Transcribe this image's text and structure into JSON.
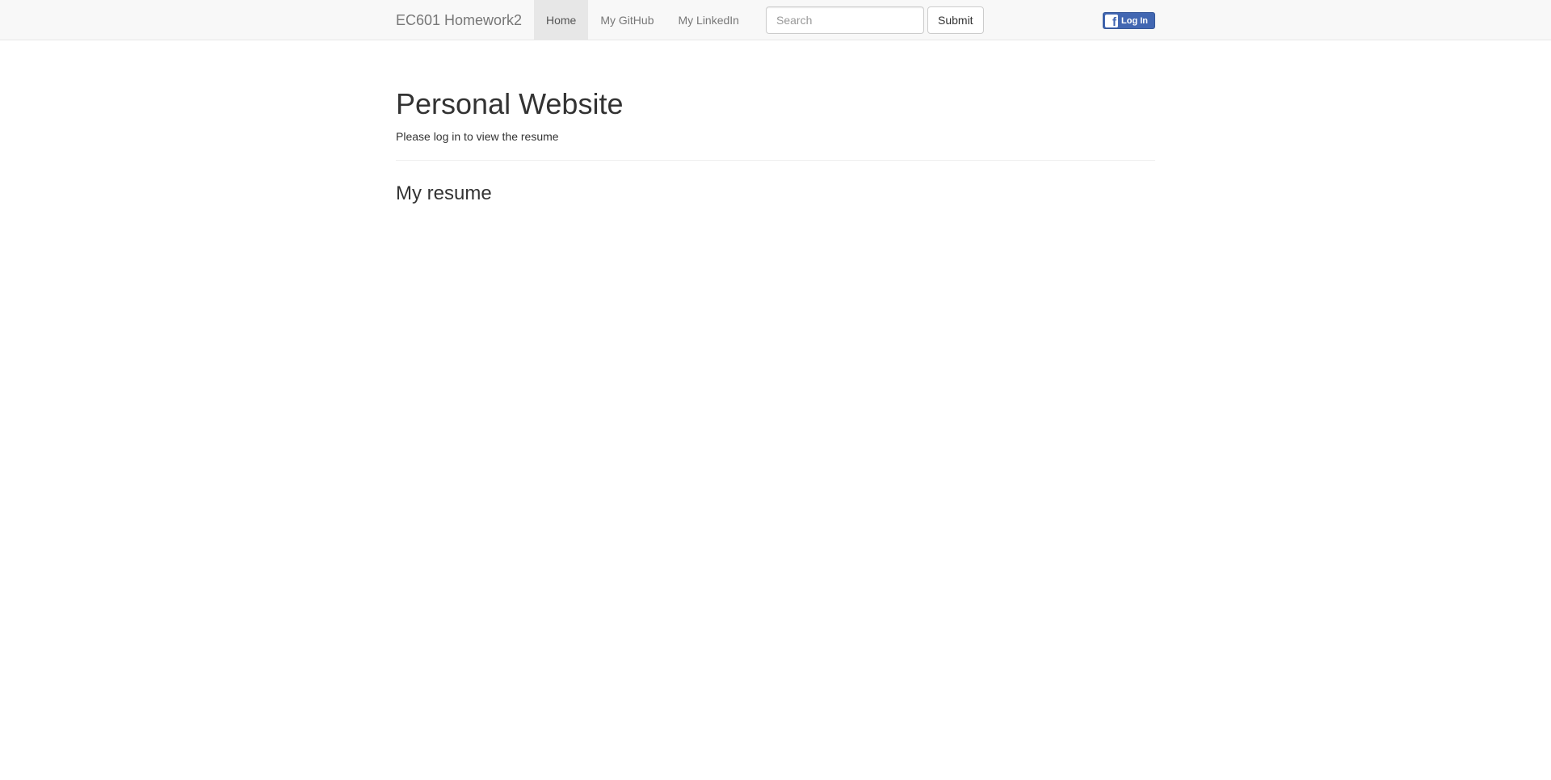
{
  "navbar": {
    "brand": "EC601 Homework2",
    "links": [
      {
        "label": "Home",
        "active": true
      },
      {
        "label": "My GitHub",
        "active": false
      },
      {
        "label": "My LinkedIn",
        "active": false
      }
    ],
    "search": {
      "placeholder": "Search",
      "value": ""
    },
    "submit_label": "Submit",
    "facebook": {
      "icon": "facebook-f-icon",
      "label": "Log In",
      "color": "#4267b2"
    }
  },
  "main": {
    "title": "Personal Website",
    "subtitle": "Please log in to view the resume",
    "section_title": "My resume"
  }
}
